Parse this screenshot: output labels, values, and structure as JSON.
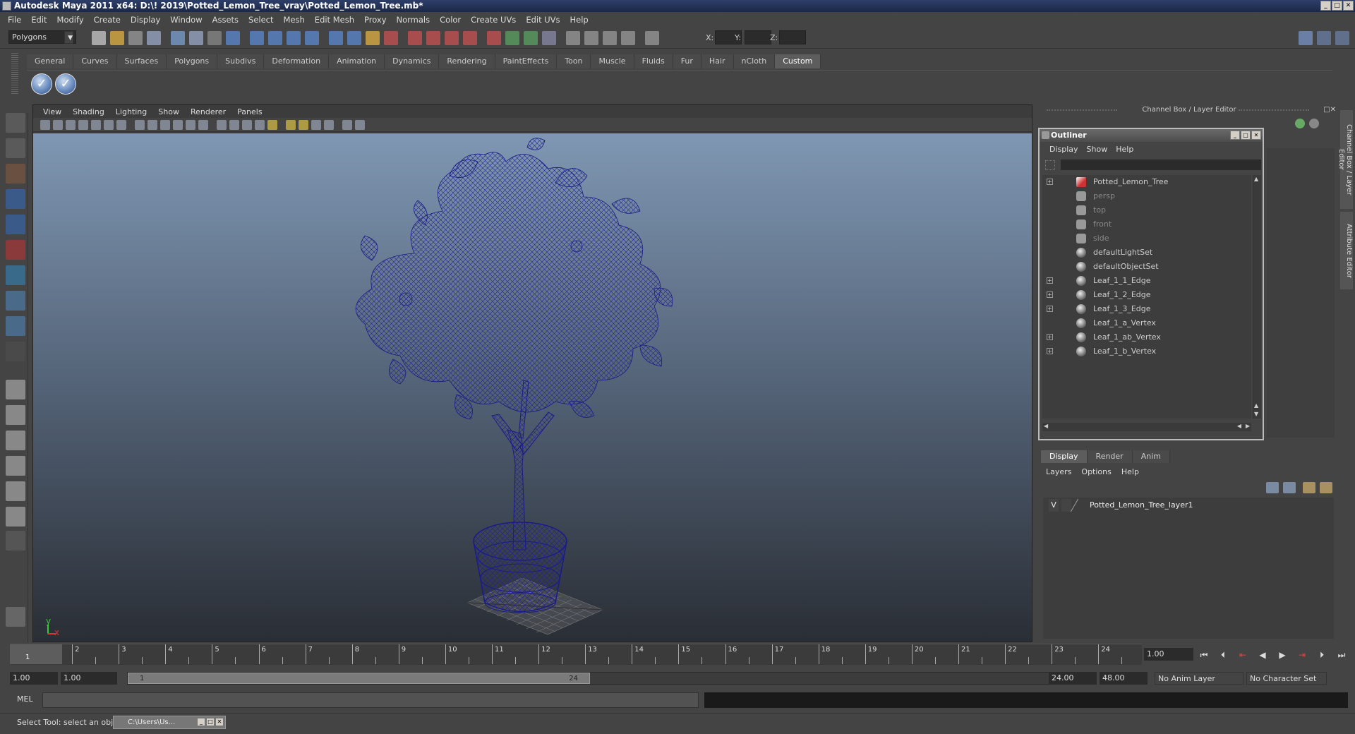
{
  "window": {
    "title": "Autodesk Maya 2011 x64: D:\\! 2019\\Potted_Lemon_Tree_vray\\Potted_Lemon_Tree.mb*"
  },
  "menubar": [
    "File",
    "Edit",
    "Modify",
    "Create",
    "Display",
    "Window",
    "Assets",
    "Select",
    "Mesh",
    "Edit Mesh",
    "Proxy",
    "Normals",
    "Color",
    "Create UVs",
    "Edit UVs",
    "Help"
  ],
  "status": {
    "mode": "Polygons",
    "x_label": "X:",
    "y_label": "Y:",
    "z_label": "Z:"
  },
  "shelf": {
    "tabs": [
      "General",
      "Curves",
      "Surfaces",
      "Polygons",
      "Subdivs",
      "Deformation",
      "Animation",
      "Dynamics",
      "Rendering",
      "PaintEffects",
      "Toon",
      "Muscle",
      "Fluids",
      "Fur",
      "Hair",
      "nCloth",
      "Custom"
    ],
    "active": "Custom",
    "icons": [
      "check-shelf-icon",
      "check-shelf-icon"
    ]
  },
  "viewport": {
    "menu": [
      "View",
      "Shading",
      "Lighting",
      "Show",
      "Renderer",
      "Panels"
    ],
    "axis_x": "x",
    "axis_y": "y",
    "wire_color": "#1a1a7a"
  },
  "channel_box": {
    "title": "Channel Box / Layer Editor",
    "side_tabs": [
      "Channel Box / Layer Editor",
      "Attribute Editor"
    ]
  },
  "outliner": {
    "title": "Outliner",
    "menu": [
      "Display",
      "Show",
      "Help"
    ],
    "items": [
      {
        "label": "Potted_Lemon_Tree",
        "type": "transform",
        "expand": true,
        "dim": false
      },
      {
        "label": "persp",
        "type": "camera",
        "expand": false,
        "dim": true
      },
      {
        "label": "top",
        "type": "camera",
        "expand": false,
        "dim": true
      },
      {
        "label": "front",
        "type": "camera",
        "expand": false,
        "dim": true
      },
      {
        "label": "side",
        "type": "camera",
        "expand": false,
        "dim": true
      },
      {
        "label": "defaultLightSet",
        "type": "set",
        "expand": false,
        "dim": false
      },
      {
        "label": "defaultObjectSet",
        "type": "set",
        "expand": false,
        "dim": false
      },
      {
        "label": "Leaf_1_1_Edge",
        "type": "set",
        "expand": true,
        "dim": false
      },
      {
        "label": "Leaf_1_2_Edge",
        "type": "set",
        "expand": true,
        "dim": false
      },
      {
        "label": "Leaf_1_3_Edge",
        "type": "set",
        "expand": true,
        "dim": false
      },
      {
        "label": "Leaf_1_a_Vertex",
        "type": "set",
        "expand": false,
        "dim": false
      },
      {
        "label": "Leaf_1_ab_Vertex",
        "type": "set",
        "expand": true,
        "dim": false
      },
      {
        "label": "Leaf_1_b_Vertex",
        "type": "set",
        "expand": true,
        "dim": false
      }
    ]
  },
  "layer_editor": {
    "tabs": [
      "Display",
      "Render",
      "Anim"
    ],
    "active": "Display",
    "menu": [
      "Layers",
      "Options",
      "Help"
    ],
    "layers": [
      {
        "visible": "V",
        "name": "Potted_Lemon_Tree_layer1"
      }
    ]
  },
  "timeline": {
    "ticks": [
      "1",
      "2",
      "3",
      "4",
      "5",
      "6",
      "7",
      "8",
      "9",
      "10",
      "11",
      "12",
      "13",
      "14",
      "15",
      "16",
      "17",
      "18",
      "19",
      "20",
      "21",
      "22",
      "23",
      "24"
    ],
    "current_frame": "1",
    "current_time": "1.00"
  },
  "range": {
    "start": "1.00",
    "playback_start": "1.00",
    "slider_start": "1",
    "slider_end": "24",
    "playback_end": "24.00",
    "end": "48.00",
    "anim_layer": "No Anim Layer",
    "char_set": "No Character Set"
  },
  "command": {
    "label": "MEL"
  },
  "help_line": {
    "text": "Select Tool: select an object",
    "task": "C:\\Users\\Us..."
  }
}
